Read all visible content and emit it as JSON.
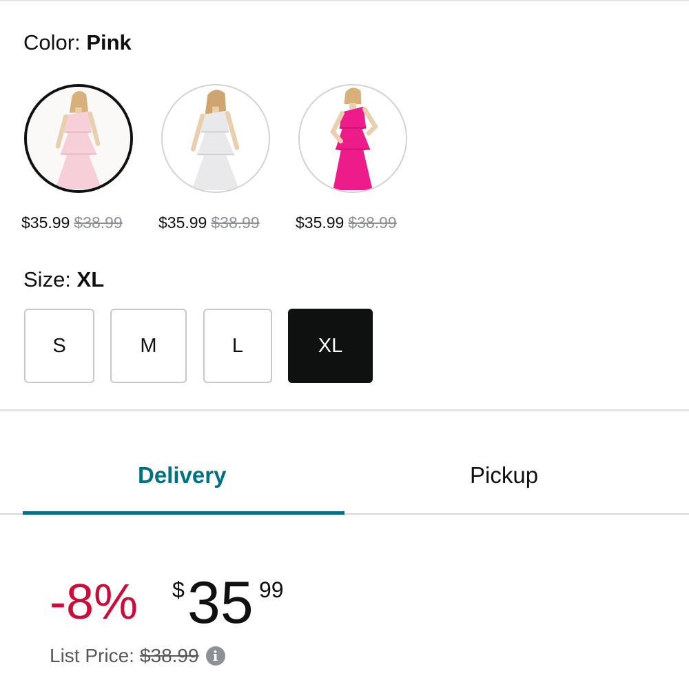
{
  "colors": {
    "accent": "#007185",
    "discount_red": "#cc0c39",
    "text": "#0f1111",
    "muted": "#565959",
    "strike": "#8d9096"
  },
  "color_selector": {
    "label": "Color:",
    "selected": "Pink",
    "options": [
      {
        "name": "Light Pink",
        "price": "$35.99",
        "list_price": "$38.99",
        "dress_color": "#f6cfd8",
        "selected": true
      },
      {
        "name": "White",
        "price": "$35.99",
        "list_price": "$38.99",
        "dress_color": "#e9e9ec",
        "selected": false
      },
      {
        "name": "Hot Pink",
        "price": "$35.99",
        "list_price": "$38.99",
        "dress_color": "#ee1c8a",
        "selected": false
      }
    ]
  },
  "size_selector": {
    "label": "Size:",
    "selected": "XL",
    "options": [
      "S",
      "M",
      "L",
      "XL"
    ]
  },
  "tabs": [
    {
      "label": "Delivery",
      "active": true
    },
    {
      "label": "Pickup",
      "active": false
    }
  ],
  "price_block": {
    "discount": "-8%",
    "currency": "$",
    "whole": "35",
    "fraction": "99",
    "list_price_label": "List Price:",
    "list_price": "$38.99",
    "info_icon": "info-icon"
  }
}
